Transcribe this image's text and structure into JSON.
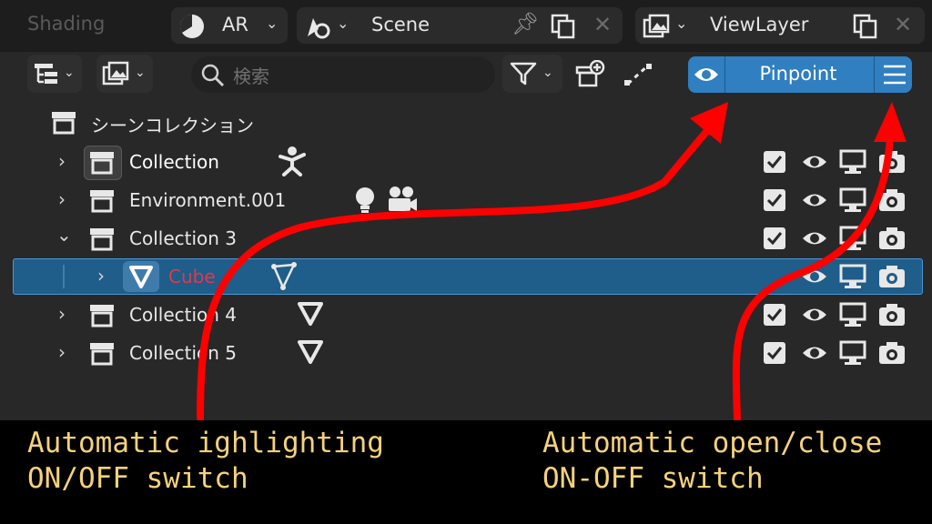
{
  "header": {
    "workspace_tab": "Shading",
    "mode_label": "AR",
    "scene_name": "Scene",
    "view_layer_name": "ViewLayer"
  },
  "toolbar": {
    "search_placeholder": "検索",
    "pinpoint_label": "Pinpoint"
  },
  "outliner": {
    "root_label": "シーンコレクション",
    "rows": [
      {
        "label": "Collection",
        "expanded": false,
        "selected": false
      },
      {
        "label": "Environment.001",
        "expanded": false,
        "selected": false
      },
      {
        "label": "Collection 3",
        "expanded": true,
        "selected": false
      },
      {
        "label": "Cube",
        "expanded": false,
        "selected": true
      },
      {
        "label": "Collection 4",
        "expanded": false,
        "selected": false
      },
      {
        "label": "Collection 5",
        "expanded": false,
        "selected": false
      }
    ]
  },
  "annotations": {
    "left_line1": "Automatic ighlighting",
    "left_line2": "ON/OFF switch",
    "right_line1": "Automatic open/close",
    "right_line2": "ON-OFF switch"
  },
  "colors": {
    "accent": "#2f7fc1",
    "selection": "#1f5d8a",
    "arrow": "#ff0000",
    "caption_text": "#f5d27a",
    "cube_label": "#e0394b"
  }
}
